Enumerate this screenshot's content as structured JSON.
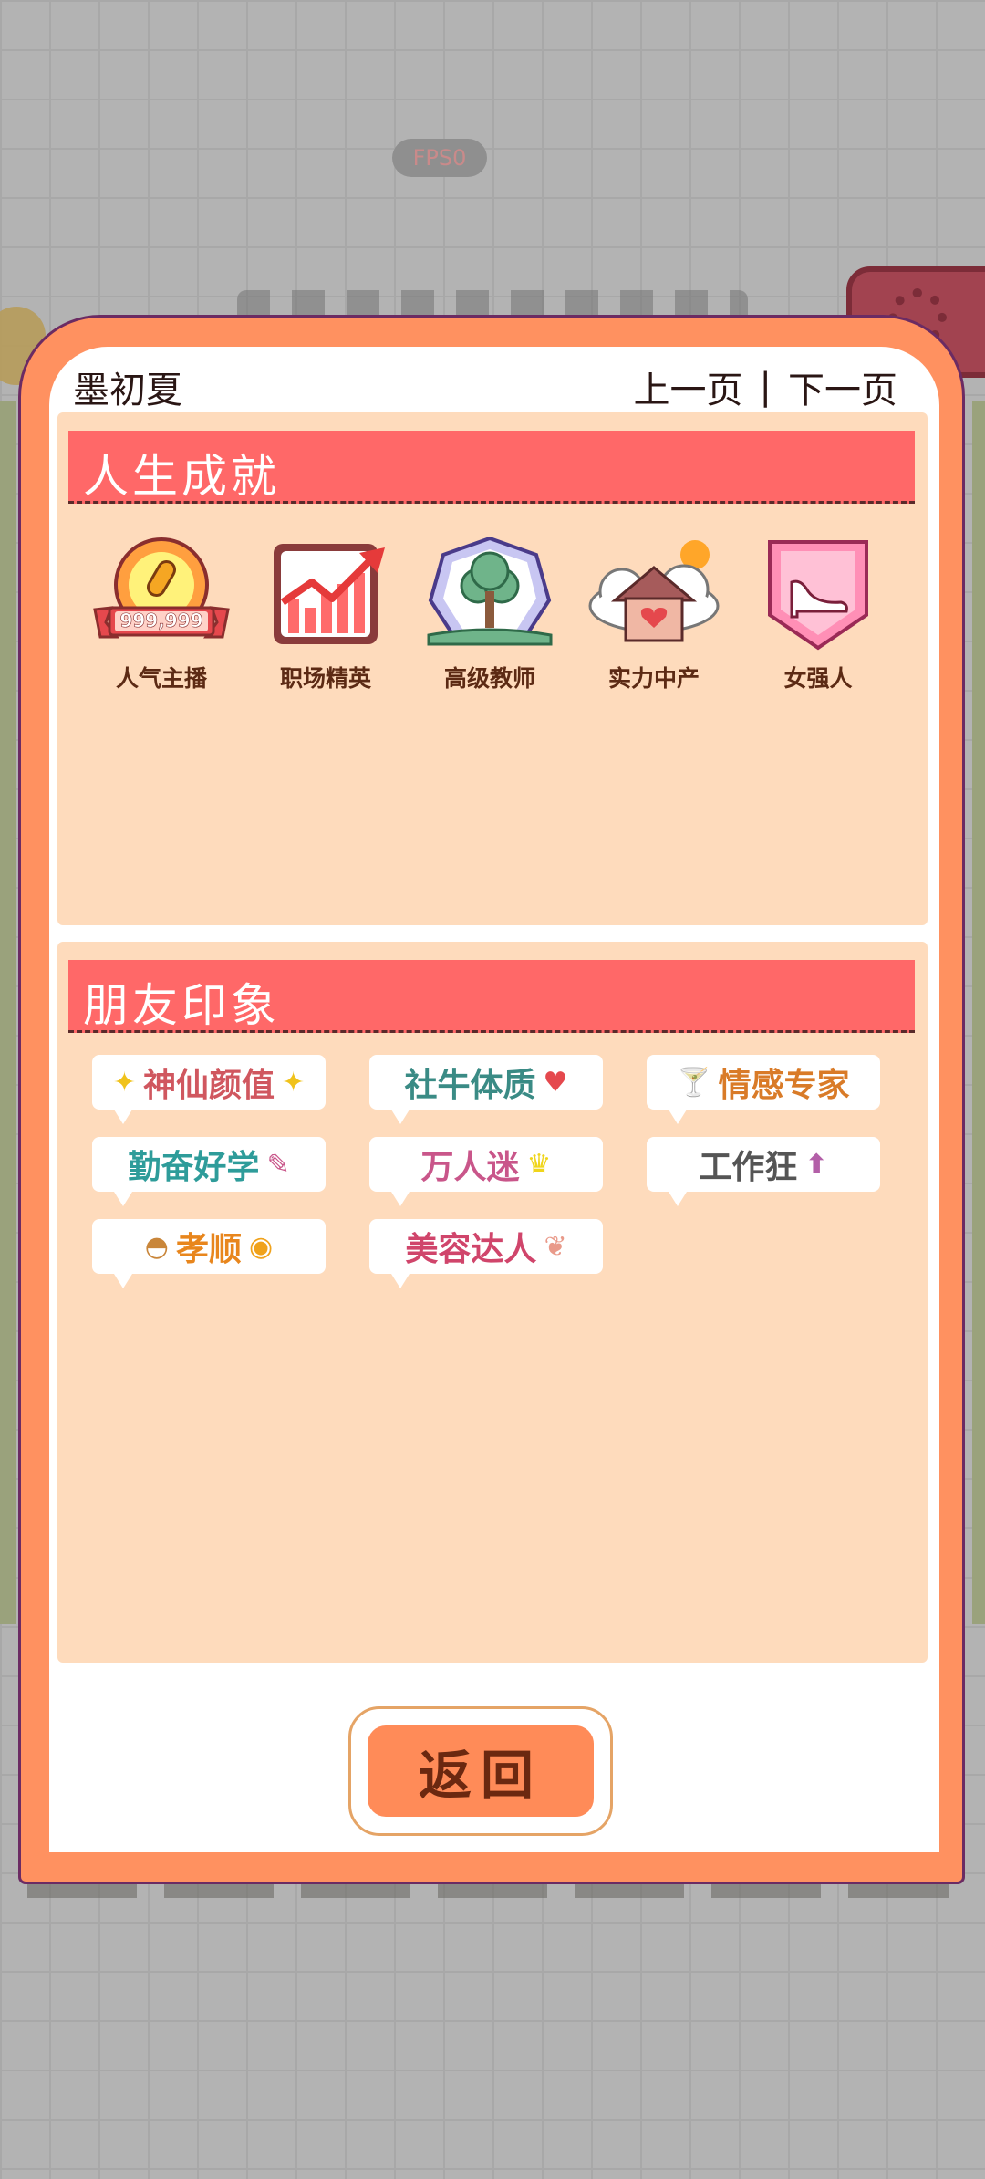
{
  "hud": {
    "fps": "FPS0"
  },
  "header": {
    "player_name": "墨初夏",
    "prev_page": "上一页",
    "separator": "|",
    "next_page": "下一页"
  },
  "achievements": {
    "title": "人生成就",
    "items": [
      {
        "label": "人气主播",
        "icon": "microphone-badge-icon",
        "badge_text": "999,999"
      },
      {
        "label": "职场精英",
        "icon": "rising-chart-icon"
      },
      {
        "label": "高级教师",
        "icon": "tree-book-icon"
      },
      {
        "label": "实力中产",
        "icon": "house-heart-icon"
      },
      {
        "label": "女强人",
        "icon": "high-heel-icon"
      }
    ]
  },
  "impressions": {
    "title": "朋友印象",
    "tags": [
      {
        "label": "神仙颜值",
        "icon": "sparkle-icon",
        "color": "#d0575f"
      },
      {
        "label": "社牛体质",
        "icon": "heart-bubble-icon",
        "color": "#3a8b85"
      },
      {
        "label": "情感专家",
        "icon": "cocktail-glasses-icon",
        "color": "#d97b28"
      },
      {
        "label": "勤奋好学",
        "icon": "pencil-icon",
        "color": "#2e9c9a"
      },
      {
        "label": "万人迷",
        "icon": "crown-icon",
        "color": "#c9568a"
      },
      {
        "label": "工作狂",
        "icon": "up-arrow-icon",
        "color": "#555555"
      },
      {
        "label": "孝顺",
        "icon": "muffin-egg-icon",
        "color": "#e8861d"
      },
      {
        "label": "美容达人",
        "icon": "wing-icon",
        "color": "#d0456b"
      }
    ]
  },
  "footer": {
    "back_label": "返回"
  }
}
